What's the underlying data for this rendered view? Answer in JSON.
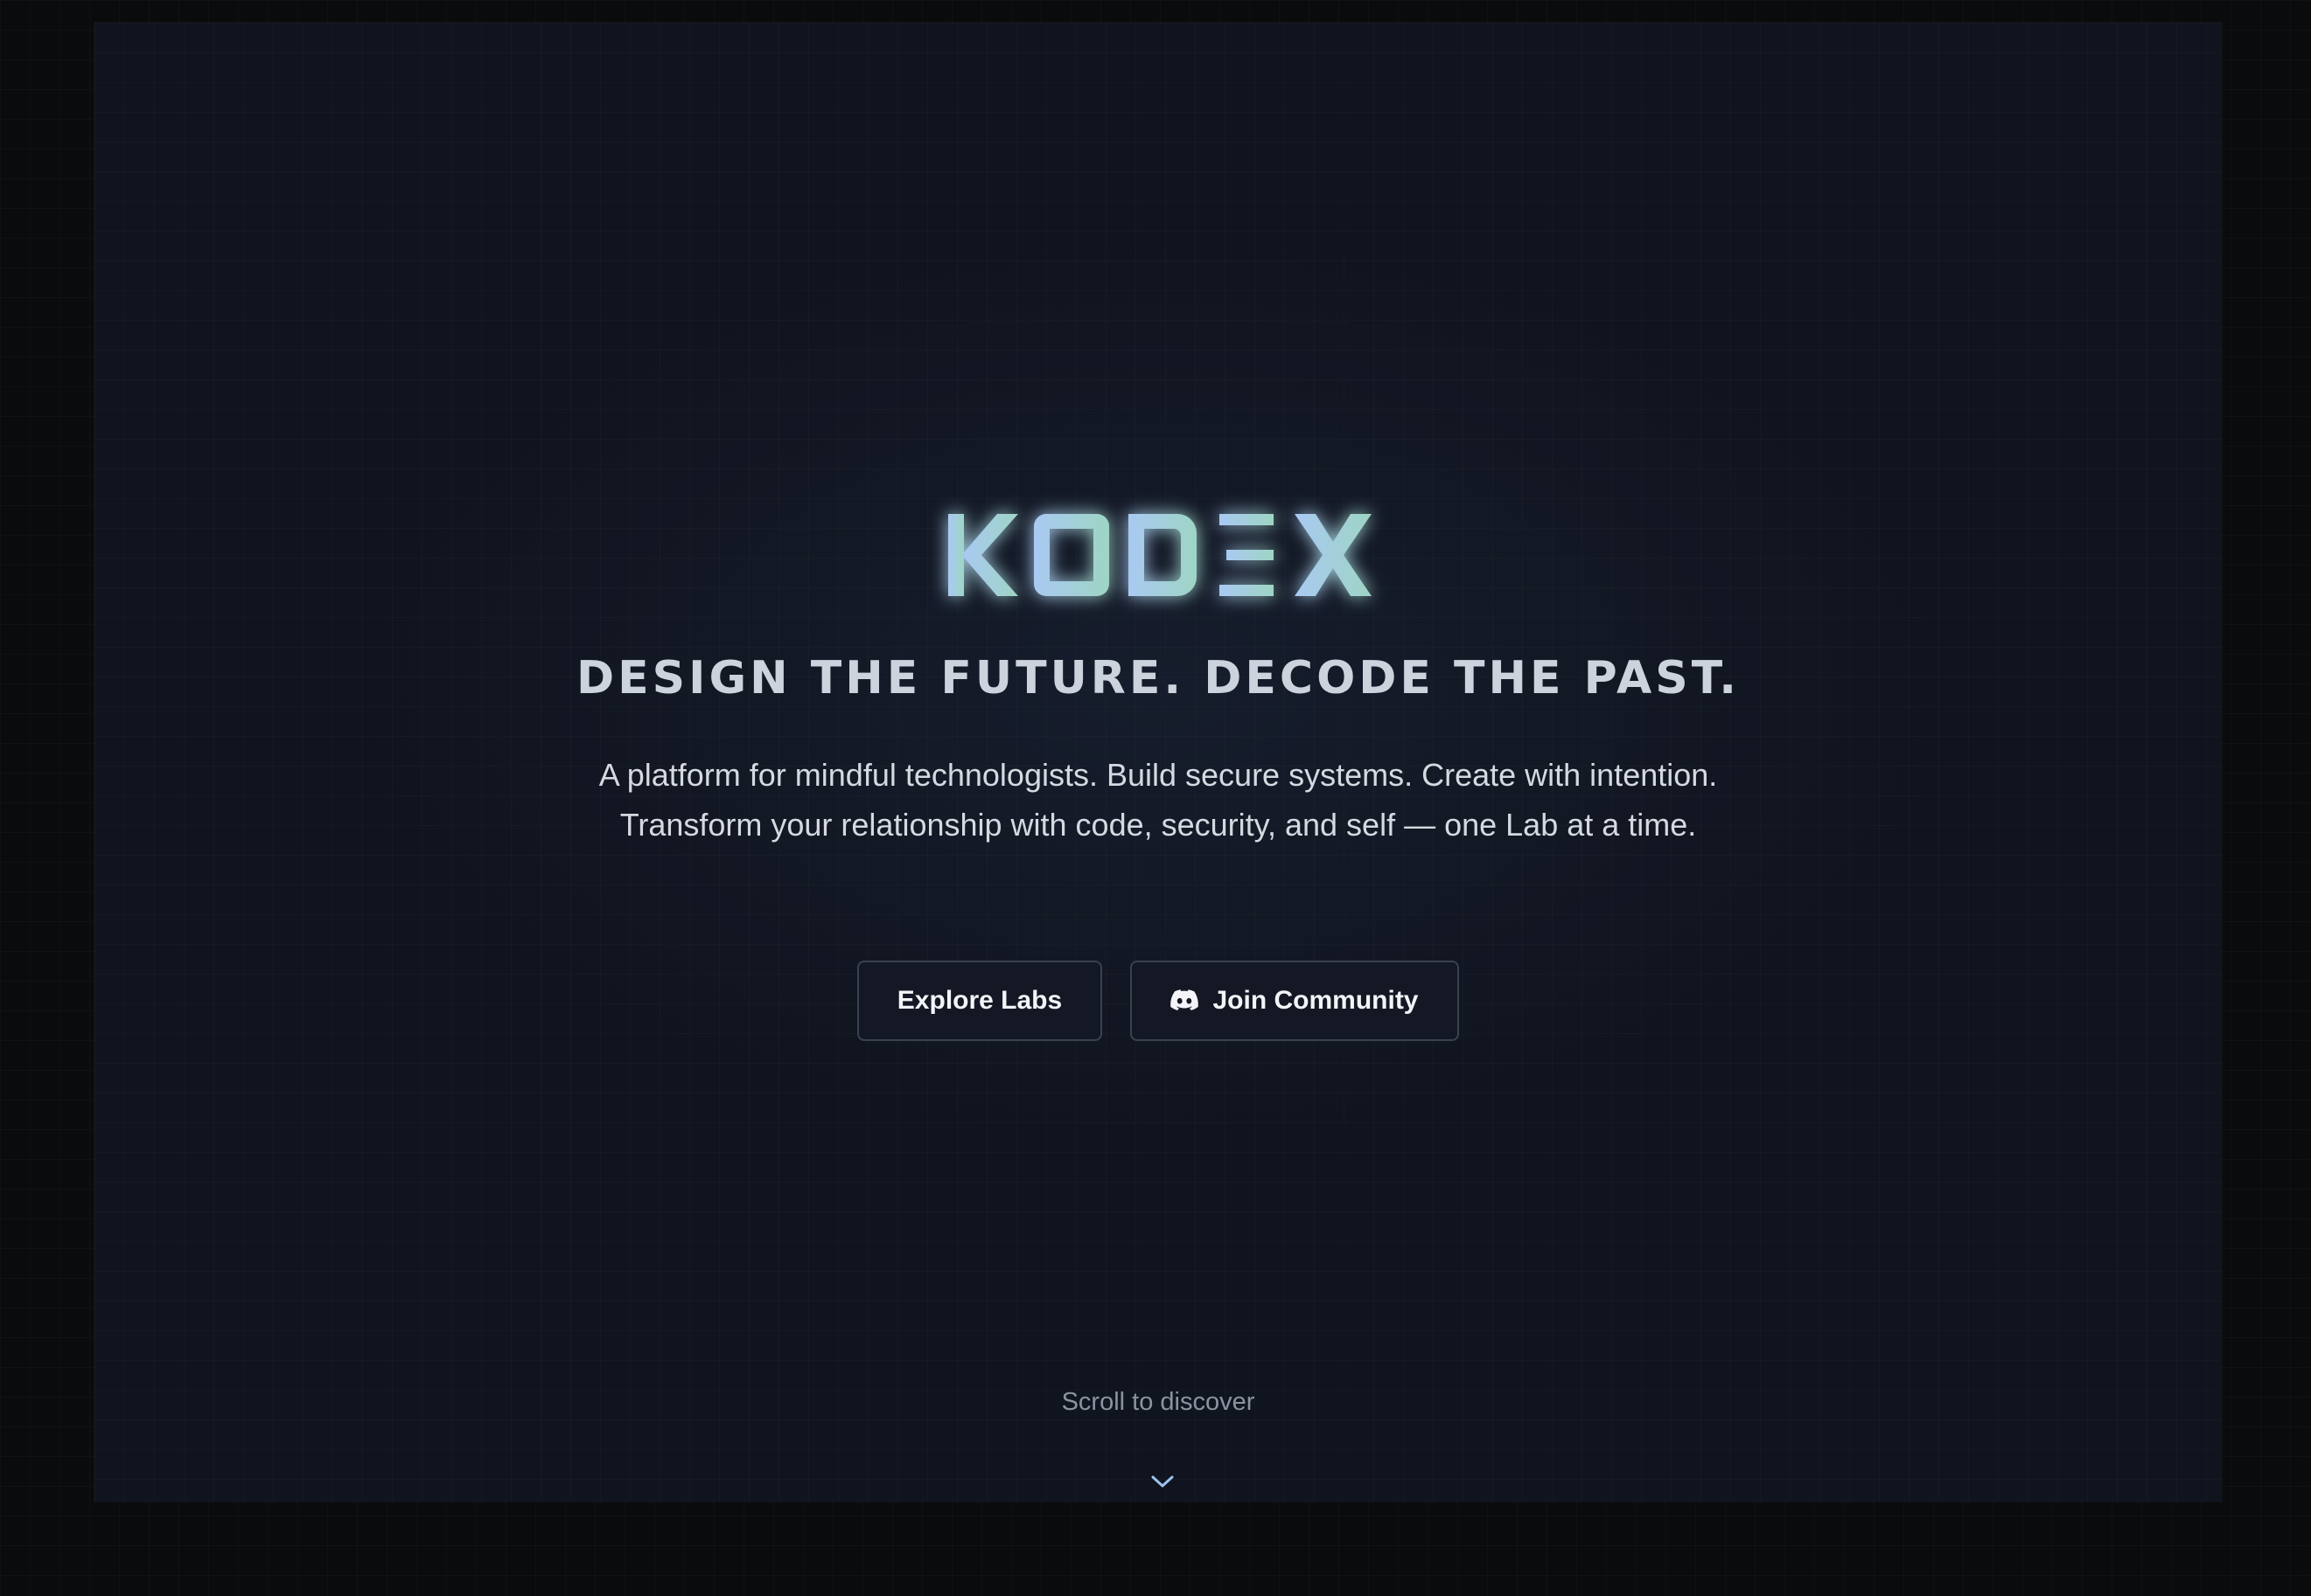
{
  "hero": {
    "logo_text": "KODEX",
    "headline": "DESIGN THE FUTURE. DECODE THE PAST.",
    "description": "A platform for mindful technologists. Build secure systems. Create with intention. Transform your relationship with code, security, and self — one Lab at a time."
  },
  "buttons": {
    "explore_label": "Explore Labs",
    "community_label": "Join Community",
    "community_icon": "discord-icon"
  },
  "scroll": {
    "label": "Scroll to discover",
    "icon": "chevron-down-icon"
  },
  "colors": {
    "page_background": "#0a0b0d",
    "hero_background": "#10141e",
    "logo_gradient_start": "#a8c8f0",
    "logo_gradient_end": "#9fd6c6",
    "button_border": "#3a4150",
    "chevron": "#9cc2ee"
  }
}
